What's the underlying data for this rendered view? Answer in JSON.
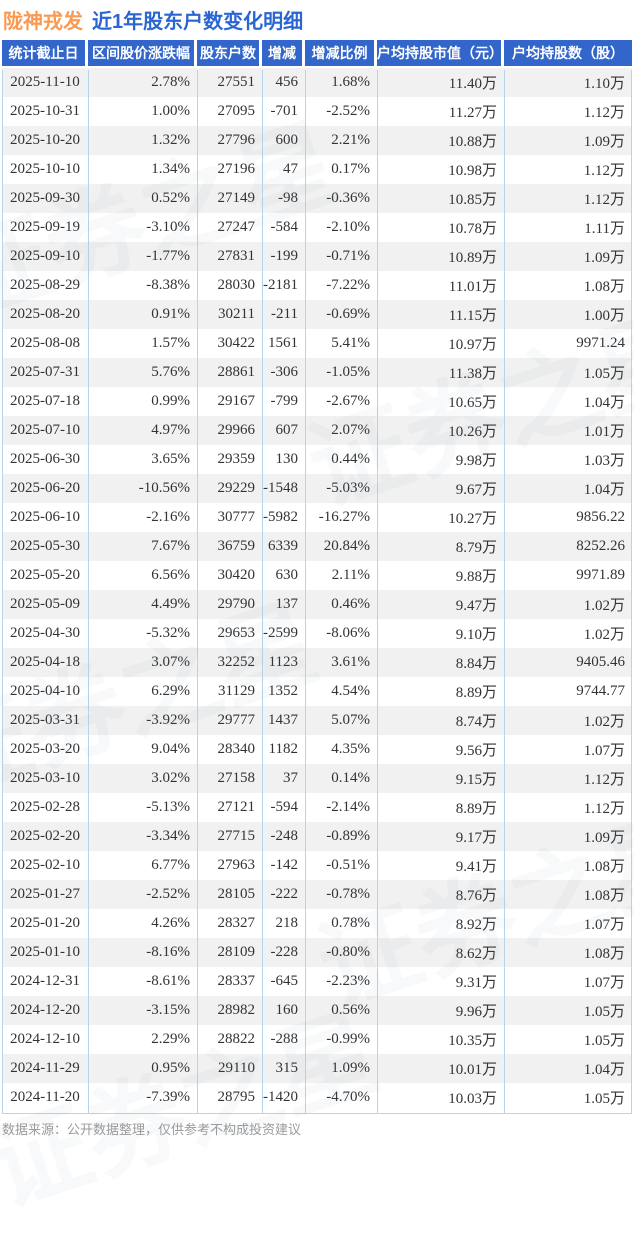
{
  "page_title": {
    "stock_name": "陇神戎发",
    "report_title": "近1年股东户数变化明细"
  },
  "watermark_text": "证券之星",
  "footer_note": "数据来源：公开数据整理，仅供参考不构成投资建议",
  "colors": {
    "header_bg": "#3366cb",
    "increase_red": "#f02c2c",
    "decrease_green": "#1fa24e",
    "title_orange": "#fa9a52",
    "title_blue": "#2a66d2"
  },
  "chart_data": {
    "type": "table",
    "title": "陇神戎发 近1年股东户数变化明细",
    "columns": [
      "统计截止日",
      "区间股价涨跌幅",
      "股东户数",
      "增减",
      "增减比例",
      "户均持股市值（元）",
      "户均持股数（股）"
    ],
    "signed_value_columns": [
      1,
      3,
      4
    ],
    "rows": [
      [
        "2025-11-10",
        "2.78%",
        "27551",
        "456",
        "1.68%",
        "11.40万",
        "1.10万"
      ],
      [
        "2025-10-31",
        "1.00%",
        "27095",
        "-701",
        "-2.52%",
        "11.27万",
        "1.12万"
      ],
      [
        "2025-10-20",
        "1.32%",
        "27796",
        "600",
        "2.21%",
        "10.88万",
        "1.09万"
      ],
      [
        "2025-10-10",
        "1.34%",
        "27196",
        "47",
        "0.17%",
        "10.98万",
        "1.12万"
      ],
      [
        "2025-09-30",
        "0.52%",
        "27149",
        "-98",
        "-0.36%",
        "10.85万",
        "1.12万"
      ],
      [
        "2025-09-19",
        "-3.10%",
        "27247",
        "-584",
        "-2.10%",
        "10.78万",
        "1.11万"
      ],
      [
        "2025-09-10",
        "-1.77%",
        "27831",
        "-199",
        "-0.71%",
        "10.89万",
        "1.09万"
      ],
      [
        "2025-08-29",
        "-8.38%",
        "28030",
        "-2181",
        "-7.22%",
        "11.01万",
        "1.08万"
      ],
      [
        "2025-08-20",
        "0.91%",
        "30211",
        "-211",
        "-0.69%",
        "11.15万",
        "1.00万"
      ],
      [
        "2025-08-08",
        "1.57%",
        "30422",
        "1561",
        "5.41%",
        "10.97万",
        "9971.24"
      ],
      [
        "2025-07-31",
        "5.76%",
        "28861",
        "-306",
        "-1.05%",
        "11.38万",
        "1.05万"
      ],
      [
        "2025-07-18",
        "0.99%",
        "29167",
        "-799",
        "-2.67%",
        "10.65万",
        "1.04万"
      ],
      [
        "2025-07-10",
        "4.97%",
        "29966",
        "607",
        "2.07%",
        "10.26万",
        "1.01万"
      ],
      [
        "2025-06-30",
        "3.65%",
        "29359",
        "130",
        "0.44%",
        "9.98万",
        "1.03万"
      ],
      [
        "2025-06-20",
        "-10.56%",
        "29229",
        "-1548",
        "-5.03%",
        "9.67万",
        "1.04万"
      ],
      [
        "2025-06-10",
        "-2.16%",
        "30777",
        "-5982",
        "-16.27%",
        "10.27万",
        "9856.22"
      ],
      [
        "2025-05-30",
        "7.67%",
        "36759",
        "6339",
        "20.84%",
        "8.79万",
        "8252.26"
      ],
      [
        "2025-05-20",
        "6.56%",
        "30420",
        "630",
        "2.11%",
        "9.88万",
        "9971.89"
      ],
      [
        "2025-05-09",
        "4.49%",
        "29790",
        "137",
        "0.46%",
        "9.47万",
        "1.02万"
      ],
      [
        "2025-04-30",
        "-5.32%",
        "29653",
        "-2599",
        "-8.06%",
        "9.10万",
        "1.02万"
      ],
      [
        "2025-04-18",
        "3.07%",
        "32252",
        "1123",
        "3.61%",
        "8.84万",
        "9405.46"
      ],
      [
        "2025-04-10",
        "6.29%",
        "31129",
        "1352",
        "4.54%",
        "8.89万",
        "9744.77"
      ],
      [
        "2025-03-31",
        "-3.92%",
        "29777",
        "1437",
        "5.07%",
        "8.74万",
        "1.02万"
      ],
      [
        "2025-03-20",
        "9.04%",
        "28340",
        "1182",
        "4.35%",
        "9.56万",
        "1.07万"
      ],
      [
        "2025-03-10",
        "3.02%",
        "27158",
        "37",
        "0.14%",
        "9.15万",
        "1.12万"
      ],
      [
        "2025-02-28",
        "-5.13%",
        "27121",
        "-594",
        "-2.14%",
        "8.89万",
        "1.12万"
      ],
      [
        "2025-02-20",
        "-3.34%",
        "27715",
        "-248",
        "-0.89%",
        "9.17万",
        "1.09万"
      ],
      [
        "2025-02-10",
        "6.77%",
        "27963",
        "-142",
        "-0.51%",
        "9.41万",
        "1.08万"
      ],
      [
        "2025-01-27",
        "-2.52%",
        "28105",
        "-222",
        "-0.78%",
        "8.76万",
        "1.08万"
      ],
      [
        "2025-01-20",
        "4.26%",
        "28327",
        "218",
        "0.78%",
        "8.92万",
        "1.07万"
      ],
      [
        "2025-01-10",
        "-8.16%",
        "28109",
        "-228",
        "-0.80%",
        "8.62万",
        "1.08万"
      ],
      [
        "2024-12-31",
        "-8.61%",
        "28337",
        "-645",
        "-2.23%",
        "9.31万",
        "1.07万"
      ],
      [
        "2024-12-20",
        "-3.15%",
        "28982",
        "160",
        "0.56%",
        "9.96万",
        "1.05万"
      ],
      [
        "2024-12-10",
        "2.29%",
        "28822",
        "-288",
        "-0.99%",
        "10.35万",
        "1.05万"
      ],
      [
        "2024-11-29",
        "0.95%",
        "29110",
        "315",
        "1.09%",
        "10.01万",
        "1.04万"
      ],
      [
        "2024-11-20",
        "-7.39%",
        "28795",
        "-1420",
        "-4.70%",
        "10.03万",
        "1.05万"
      ]
    ]
  }
}
